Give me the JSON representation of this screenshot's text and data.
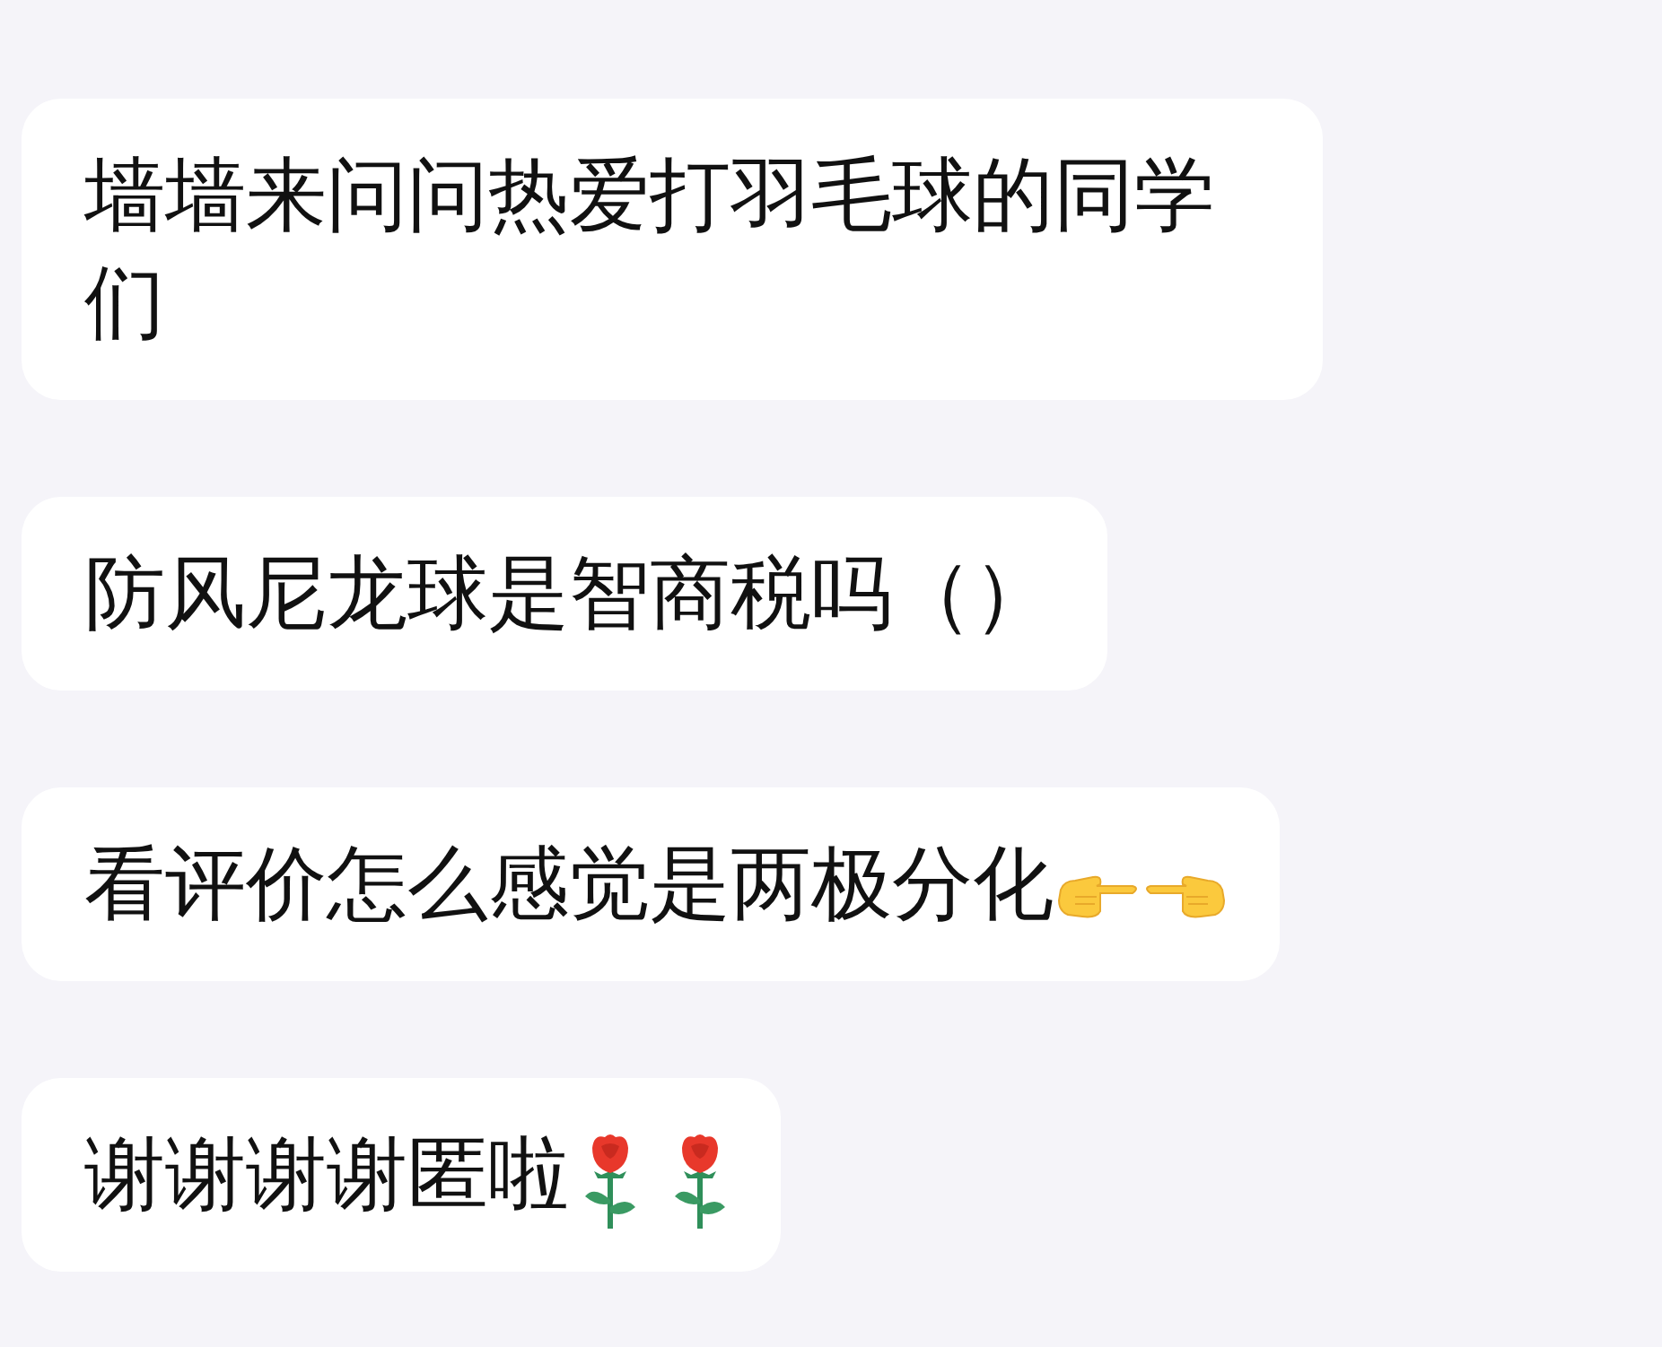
{
  "messages": [
    {
      "text": "墙墙来问问热爱打羽毛球的同学们"
    },
    {
      "text": "防风尼龙球是智商税吗（）"
    },
    {
      "text": "看评价怎么感觉是两极分化",
      "emojis": [
        {
          "kind": "hand-pointing-right"
        },
        {
          "kind": "hand-pointing-left"
        }
      ]
    },
    {
      "text": "谢谢谢谢匿啦",
      "emojis": [
        {
          "kind": "rose"
        },
        {
          "kind": "rose"
        }
      ]
    }
  ]
}
